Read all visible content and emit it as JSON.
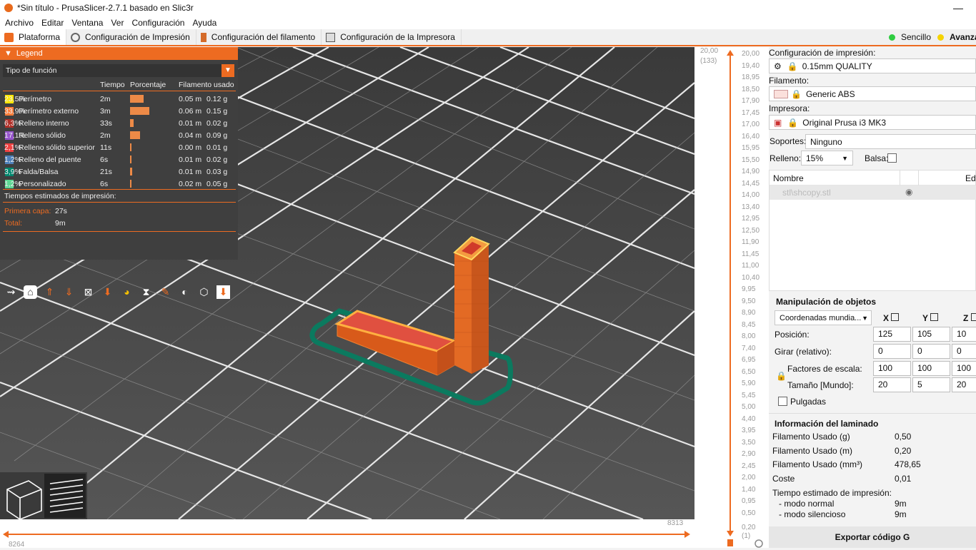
{
  "window": {
    "title": "*Sin título - PrusaSlicer-2.7.1 basado en Slic3r",
    "minimize": "—"
  },
  "menu": [
    "Archivo",
    "Editar",
    "Ventana",
    "Ver",
    "Configuración",
    "Ayuda"
  ],
  "tabs": [
    {
      "label": "Plataforma",
      "icon": "cube-icon"
    },
    {
      "label": "Configuración de Impresión",
      "icon": "gear-icon"
    },
    {
      "label": "Configuración del filamento",
      "icon": "spool-icon"
    },
    {
      "label": "Configuración de la Impresora",
      "icon": "printer-icon"
    }
  ],
  "modes": {
    "simple": "Sencillo",
    "advanced": "Avanza",
    "simple_color": "#2ecc40",
    "advanced_color": "#f5d300"
  },
  "legend": {
    "title": "Legend",
    "view_type": "Tipo de función",
    "columns": {
      "time": "Tiempo",
      "percent": "Porcentaje",
      "filament": "Filamento usado"
    },
    "rows": [
      {
        "name": "Perímetro",
        "color": "#ffe600",
        "time": "2m",
        "percent": "23,5%",
        "pct": 23.5,
        "m": "0.05 m",
        "g": "0.12 g"
      },
      {
        "name": "Perímetro externo",
        "color": "#ff7d38",
        "time": "3m",
        "percent": "33,9%",
        "pct": 33.9,
        "m": "0.06 m",
        "g": "0.15 g"
      },
      {
        "name": "Relleno interno",
        "color": "#b03029",
        "time": "33s",
        "percent": "6,3%",
        "pct": 6.3,
        "m": "0.01 m",
        "g": "0.02 g"
      },
      {
        "name": "Relleno sólido",
        "color": "#9654cc",
        "time": "2m",
        "percent": "17,1%",
        "pct": 17.1,
        "m": "0.04 m",
        "g": "0.09 g"
      },
      {
        "name": "Relleno sólido superior",
        "color": "#f04040",
        "time": "11s",
        "percent": "2,1%",
        "pct": 2.1,
        "m": "0.00 m",
        "g": "0.01 g"
      },
      {
        "name": "Relleno del puente",
        "color": "#4d80ba",
        "time": "6s",
        "percent": "1,2%",
        "pct": 1.2,
        "m": "0.01 m",
        "g": "0.02 g"
      },
      {
        "name": "Falda/Balsa",
        "color": "#00876e",
        "time": "21s",
        "percent": "3,9%",
        "pct": 3.9,
        "m": "0.01 m",
        "g": "0.03 g"
      },
      {
        "name": "Personalizado",
        "color": "#5ed694",
        "time": "6s",
        "percent": "1,2%",
        "pct": 1.2,
        "m": "0.02 m",
        "g": "0.05 g"
      }
    ],
    "est_title": "Tiempos estimados de impresión:",
    "first_layer_label": "Primera capa:",
    "first_layer_value": "27s",
    "total_label": "Total:",
    "total_value": "9m"
  },
  "sliders": {
    "h_left": "8264",
    "h_right": "8313",
    "v_top": "20,00",
    "v_top_sub": "(133)",
    "v_bottom": "0,20",
    "v_bottom_sub": "(1)",
    "v_labels": [
      "20,00",
      "19,40",
      "18,95",
      "18,50",
      "17,90",
      "17,45",
      "17,00",
      "16,40",
      "15,95",
      "15,50",
      "14,90",
      "14,45",
      "14,00",
      "13,40",
      "12,95",
      "12,50",
      "11,90",
      "11,45",
      "11,00",
      "10,40",
      "9,95",
      "9,50",
      "8,90",
      "8,45",
      "8,00",
      "7,40",
      "6,95",
      "6,50",
      "5,90",
      "5,45",
      "5,00",
      "4,40",
      "3,95",
      "3,50",
      "2,90",
      "2,45",
      "2,00",
      "1,40",
      "0,95",
      "0,50"
    ]
  },
  "right": {
    "print_label": "Configuración de impresión:",
    "print_value": "0.15mm QUALITY",
    "filament_label": "Filamento:",
    "filament_value": "Generic ABS",
    "printer_label": "Impresora:",
    "printer_value": "Original Prusa i3 MK3",
    "supports_label": "Soportes:",
    "supports_value": "Ninguno",
    "infill_label": "Relleno:",
    "infill_value": "15%",
    "brim_label": "Balsa:",
    "list_name": "Nombre",
    "list_edit": "Edi",
    "object_name": "stl\\shcopy.stl",
    "manip_title": "Manipulación de objetos",
    "coord_value": "Coordenadas mundia...",
    "axes": [
      "X",
      "Y",
      "Z"
    ],
    "position_label": "Posición:",
    "position": [
      "125",
      "105",
      "10"
    ],
    "rotate_label": "Girar (relativo):",
    "rotate": [
      "0",
      "0",
      "0"
    ],
    "scale_label": "Factores de escala:",
    "scale": [
      "100",
      "100",
      "100"
    ],
    "size_label": "Tamaño [Mundo]:",
    "size": [
      "20",
      "5",
      "20"
    ],
    "inches_label": "Pulgadas",
    "slice_title": "Información del laminado",
    "info": [
      {
        "k": "Filamento Usado (g)",
        "v": "0,50"
      },
      {
        "k": "Filamento Usado (m)",
        "v": "0,20"
      },
      {
        "k": "Filamento Usado (mm³)",
        "v": "478,65"
      },
      {
        "k": "Coste",
        "v": "0,01"
      }
    ],
    "est_label": "Tiempo estimado de impresión:",
    "normal_label": "- modo normal",
    "normal_value": "9m",
    "silent_label": "- modo silencioso",
    "silent_value": "9m",
    "export_label": "Exportar código G"
  }
}
